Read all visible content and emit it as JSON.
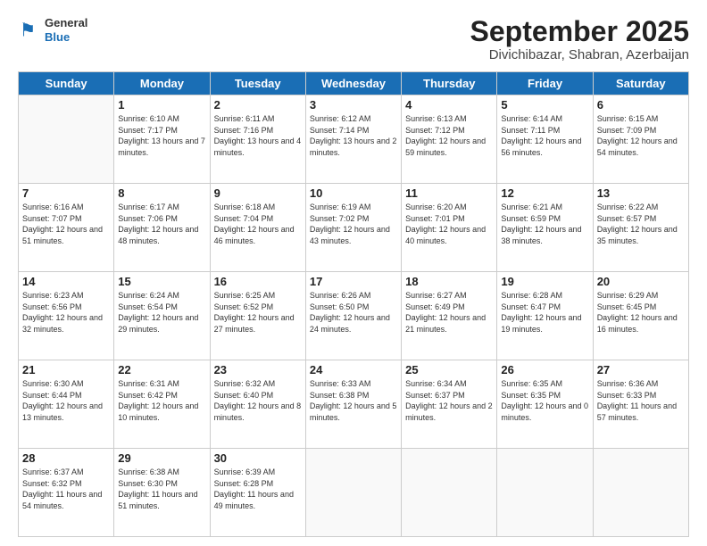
{
  "logo": {
    "general": "General",
    "blue": "Blue"
  },
  "title": {
    "month": "September 2025",
    "location": "Divichibazar, Shabran, Azerbaijan"
  },
  "header_days": [
    "Sunday",
    "Monday",
    "Tuesday",
    "Wednesday",
    "Thursday",
    "Friday",
    "Saturday"
  ],
  "weeks": [
    [
      {
        "day": "",
        "sunrise": "",
        "sunset": "",
        "daylight": ""
      },
      {
        "day": "1",
        "sunrise": "Sunrise: 6:10 AM",
        "sunset": "Sunset: 7:17 PM",
        "daylight": "Daylight: 13 hours and 7 minutes."
      },
      {
        "day": "2",
        "sunrise": "Sunrise: 6:11 AM",
        "sunset": "Sunset: 7:16 PM",
        "daylight": "Daylight: 13 hours and 4 minutes."
      },
      {
        "day": "3",
        "sunrise": "Sunrise: 6:12 AM",
        "sunset": "Sunset: 7:14 PM",
        "daylight": "Daylight: 13 hours and 2 minutes."
      },
      {
        "day": "4",
        "sunrise": "Sunrise: 6:13 AM",
        "sunset": "Sunset: 7:12 PM",
        "daylight": "Daylight: 12 hours and 59 minutes."
      },
      {
        "day": "5",
        "sunrise": "Sunrise: 6:14 AM",
        "sunset": "Sunset: 7:11 PM",
        "daylight": "Daylight: 12 hours and 56 minutes."
      },
      {
        "day": "6",
        "sunrise": "Sunrise: 6:15 AM",
        "sunset": "Sunset: 7:09 PM",
        "daylight": "Daylight: 12 hours and 54 minutes."
      }
    ],
    [
      {
        "day": "7",
        "sunrise": "Sunrise: 6:16 AM",
        "sunset": "Sunset: 7:07 PM",
        "daylight": "Daylight: 12 hours and 51 minutes."
      },
      {
        "day": "8",
        "sunrise": "Sunrise: 6:17 AM",
        "sunset": "Sunset: 7:06 PM",
        "daylight": "Daylight: 12 hours and 48 minutes."
      },
      {
        "day": "9",
        "sunrise": "Sunrise: 6:18 AM",
        "sunset": "Sunset: 7:04 PM",
        "daylight": "Daylight: 12 hours and 46 minutes."
      },
      {
        "day": "10",
        "sunrise": "Sunrise: 6:19 AM",
        "sunset": "Sunset: 7:02 PM",
        "daylight": "Daylight: 12 hours and 43 minutes."
      },
      {
        "day": "11",
        "sunrise": "Sunrise: 6:20 AM",
        "sunset": "Sunset: 7:01 PM",
        "daylight": "Daylight: 12 hours and 40 minutes."
      },
      {
        "day": "12",
        "sunrise": "Sunrise: 6:21 AM",
        "sunset": "Sunset: 6:59 PM",
        "daylight": "Daylight: 12 hours and 38 minutes."
      },
      {
        "day": "13",
        "sunrise": "Sunrise: 6:22 AM",
        "sunset": "Sunset: 6:57 PM",
        "daylight": "Daylight: 12 hours and 35 minutes."
      }
    ],
    [
      {
        "day": "14",
        "sunrise": "Sunrise: 6:23 AM",
        "sunset": "Sunset: 6:56 PM",
        "daylight": "Daylight: 12 hours and 32 minutes."
      },
      {
        "day": "15",
        "sunrise": "Sunrise: 6:24 AM",
        "sunset": "Sunset: 6:54 PM",
        "daylight": "Daylight: 12 hours and 29 minutes."
      },
      {
        "day": "16",
        "sunrise": "Sunrise: 6:25 AM",
        "sunset": "Sunset: 6:52 PM",
        "daylight": "Daylight: 12 hours and 27 minutes."
      },
      {
        "day": "17",
        "sunrise": "Sunrise: 6:26 AM",
        "sunset": "Sunset: 6:50 PM",
        "daylight": "Daylight: 12 hours and 24 minutes."
      },
      {
        "day": "18",
        "sunrise": "Sunrise: 6:27 AM",
        "sunset": "Sunset: 6:49 PM",
        "daylight": "Daylight: 12 hours and 21 minutes."
      },
      {
        "day": "19",
        "sunrise": "Sunrise: 6:28 AM",
        "sunset": "Sunset: 6:47 PM",
        "daylight": "Daylight: 12 hours and 19 minutes."
      },
      {
        "day": "20",
        "sunrise": "Sunrise: 6:29 AM",
        "sunset": "Sunset: 6:45 PM",
        "daylight": "Daylight: 12 hours and 16 minutes."
      }
    ],
    [
      {
        "day": "21",
        "sunrise": "Sunrise: 6:30 AM",
        "sunset": "Sunset: 6:44 PM",
        "daylight": "Daylight: 12 hours and 13 minutes."
      },
      {
        "day": "22",
        "sunrise": "Sunrise: 6:31 AM",
        "sunset": "Sunset: 6:42 PM",
        "daylight": "Daylight: 12 hours and 10 minutes."
      },
      {
        "day": "23",
        "sunrise": "Sunrise: 6:32 AM",
        "sunset": "Sunset: 6:40 PM",
        "daylight": "Daylight: 12 hours and 8 minutes."
      },
      {
        "day": "24",
        "sunrise": "Sunrise: 6:33 AM",
        "sunset": "Sunset: 6:38 PM",
        "daylight": "Daylight: 12 hours and 5 minutes."
      },
      {
        "day": "25",
        "sunrise": "Sunrise: 6:34 AM",
        "sunset": "Sunset: 6:37 PM",
        "daylight": "Daylight: 12 hours and 2 minutes."
      },
      {
        "day": "26",
        "sunrise": "Sunrise: 6:35 AM",
        "sunset": "Sunset: 6:35 PM",
        "daylight": "Daylight: 12 hours and 0 minutes."
      },
      {
        "day": "27",
        "sunrise": "Sunrise: 6:36 AM",
        "sunset": "Sunset: 6:33 PM",
        "daylight": "Daylight: 11 hours and 57 minutes."
      }
    ],
    [
      {
        "day": "28",
        "sunrise": "Sunrise: 6:37 AM",
        "sunset": "Sunset: 6:32 PM",
        "daylight": "Daylight: 11 hours and 54 minutes."
      },
      {
        "day": "29",
        "sunrise": "Sunrise: 6:38 AM",
        "sunset": "Sunset: 6:30 PM",
        "daylight": "Daylight: 11 hours and 51 minutes."
      },
      {
        "day": "30",
        "sunrise": "Sunrise: 6:39 AM",
        "sunset": "Sunset: 6:28 PM",
        "daylight": "Daylight: 11 hours and 49 minutes."
      },
      {
        "day": "",
        "sunrise": "",
        "sunset": "",
        "daylight": ""
      },
      {
        "day": "",
        "sunrise": "",
        "sunset": "",
        "daylight": ""
      },
      {
        "day": "",
        "sunrise": "",
        "sunset": "",
        "daylight": ""
      },
      {
        "day": "",
        "sunrise": "",
        "sunset": "",
        "daylight": ""
      }
    ]
  ]
}
